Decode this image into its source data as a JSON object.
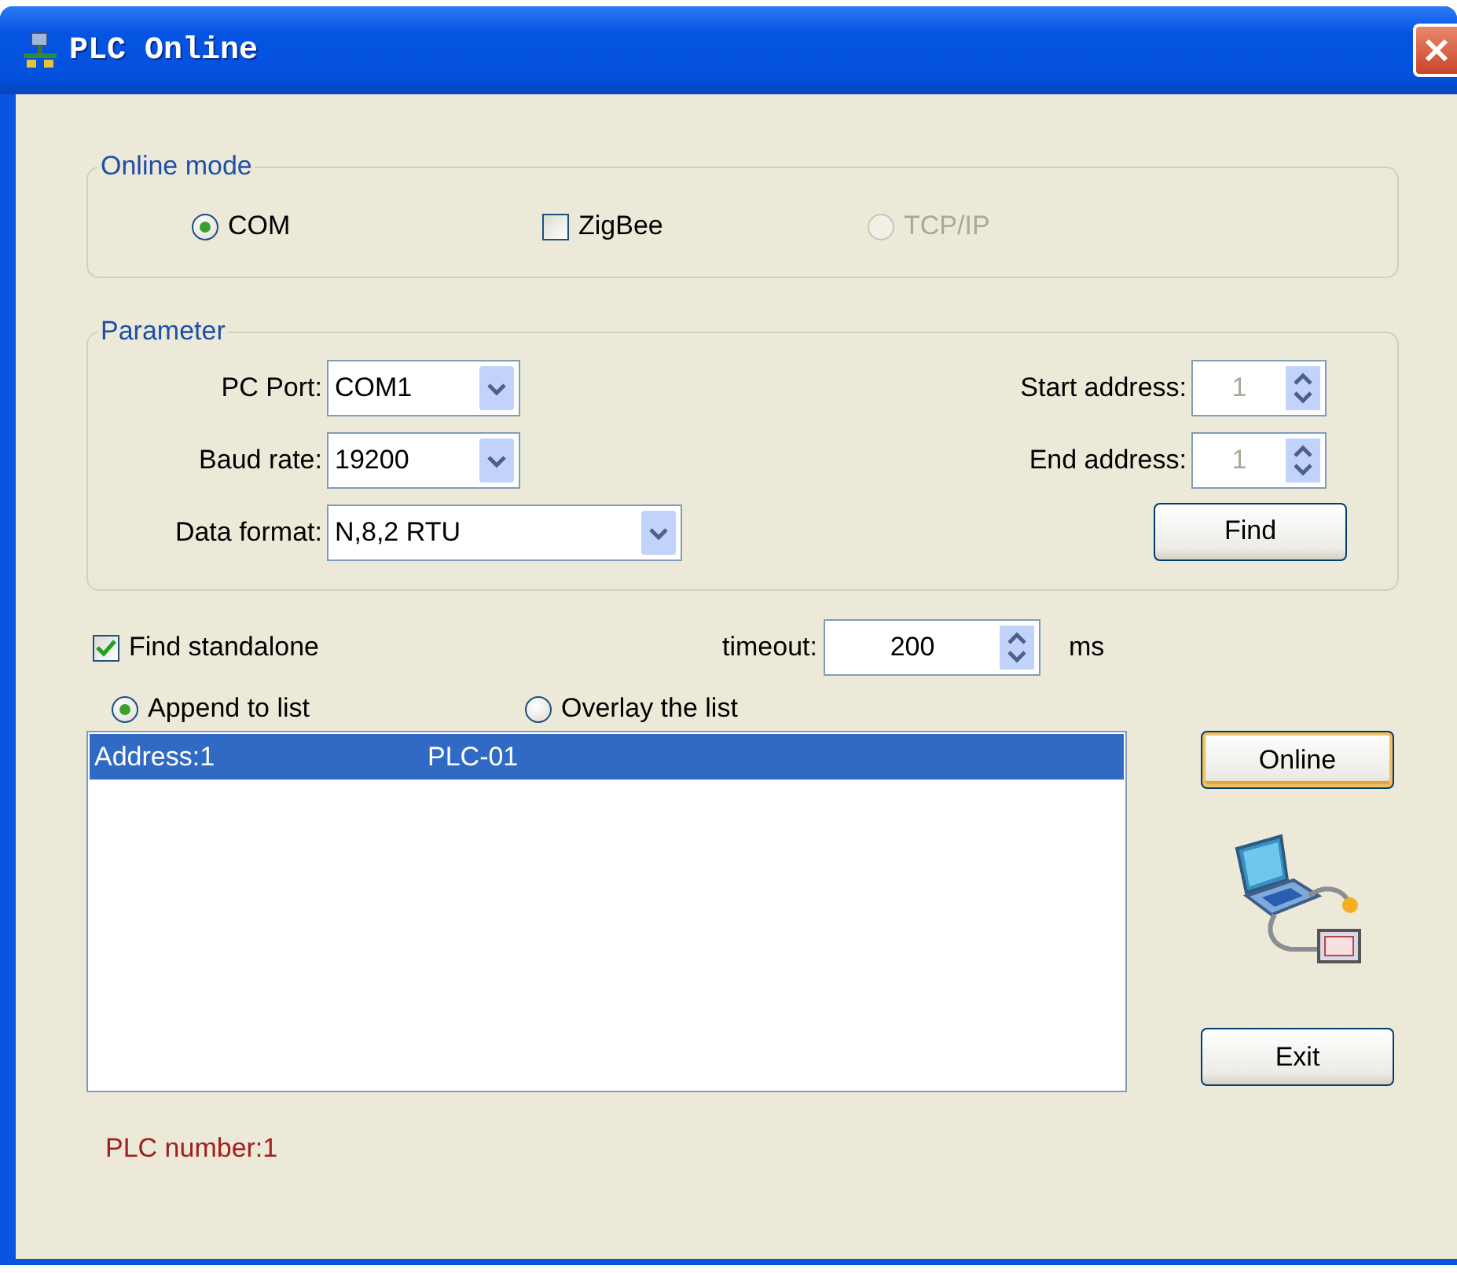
{
  "window": {
    "title": "PLC Online"
  },
  "online_mode": {
    "legend": "Online mode",
    "options": [
      {
        "kind": "radio",
        "label": "COM",
        "selected": true,
        "disabled": false
      },
      {
        "kind": "checkbox",
        "label": "ZigBee",
        "checked": false,
        "disabled": false
      },
      {
        "kind": "radio",
        "label": "TCP/IP",
        "selected": false,
        "disabled": true
      }
    ]
  },
  "parameter": {
    "legend": "Parameter",
    "combos": [
      {
        "label": "PC Port:",
        "value": "COM1"
      },
      {
        "label": "Baud rate:",
        "value": "19200"
      },
      {
        "label": "Data format:",
        "value": "N,8,2 RTU"
      }
    ],
    "spinners": [
      {
        "label": "Start address:",
        "value": "1",
        "disabled": true
      },
      {
        "label": "End address:",
        "value": "1",
        "disabled": true
      }
    ],
    "find_button": {
      "label": "Find",
      "default": false
    }
  },
  "find_standalone": {
    "label": "Find standalone",
    "checked": true
  },
  "timeout": {
    "label": "timeout:",
    "value": "200",
    "disabled": false,
    "unit": "ms"
  },
  "list_mode": [
    {
      "label": "Append to list",
      "selected": true
    },
    {
      "label": "Overlay the list",
      "selected": false
    }
  ],
  "plc_list": {
    "rows": [
      {
        "address": "Address:1",
        "name": "PLC-01",
        "selected": true
      }
    ]
  },
  "online_button": {
    "label": "Online",
    "default": true
  },
  "exit_button": {
    "label": "Exit",
    "default": false
  },
  "status": "PLC number:1"
}
